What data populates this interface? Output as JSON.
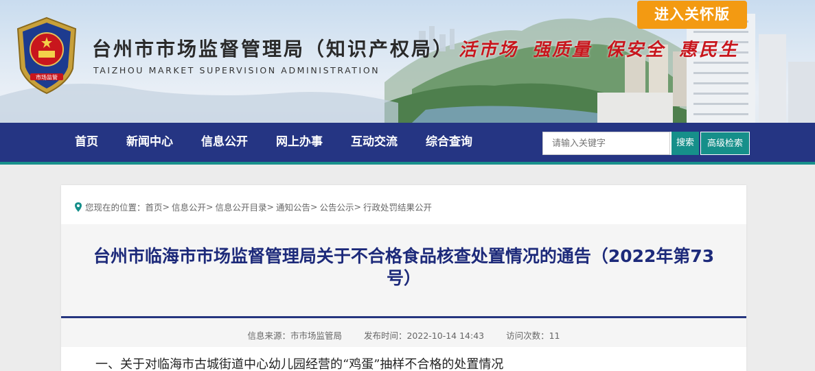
{
  "header": {
    "title": "台州市市场监督管理局（知识产权局）",
    "subtitle": "TAIZHOU MARKET SUPERVISION ADMINISTRATION",
    "slogans": [
      "活市场",
      "强质量",
      "保安全",
      "惠民生"
    ],
    "emblem_label": "市场监管",
    "care_button": "进入关怀版"
  },
  "nav": {
    "items": [
      "首页",
      "新闻中心",
      "信息公开",
      "网上办事",
      "互动交流",
      "综合查询"
    ]
  },
  "search": {
    "placeholder": "请输入关键字",
    "search_button": "搜索",
    "advanced_button": "高级检索"
  },
  "breadcrumb": {
    "prefix": "您现在的位置：",
    "items": [
      "首页",
      "信息公开",
      "信息公开目录",
      "通知公告",
      "公告公示",
      "行政处罚结果公开"
    ]
  },
  "article": {
    "title": "台州市临海市市场监督管理局关于不合格食品核查处置情况的通告（2022年第73号）",
    "source": "信息来源：市市场监管局",
    "published": "发布时间：2022-10-14 14:43",
    "views": "访问次数：11",
    "section_heading": "一、关于对临海市古城街道中心幼儿园经营的“鸡蛋”抽样不合格的处置情况"
  },
  "colors": {
    "nav_bg": "#253583",
    "accent_teal": "#168f8a",
    "care_orange": "#f39a12",
    "slogan_red": "#c8161d",
    "title_blue": "#1d2a7a"
  },
  "icons": {
    "breadcrumb": "location-pin-icon",
    "emblem": "national-emblem-icon"
  }
}
